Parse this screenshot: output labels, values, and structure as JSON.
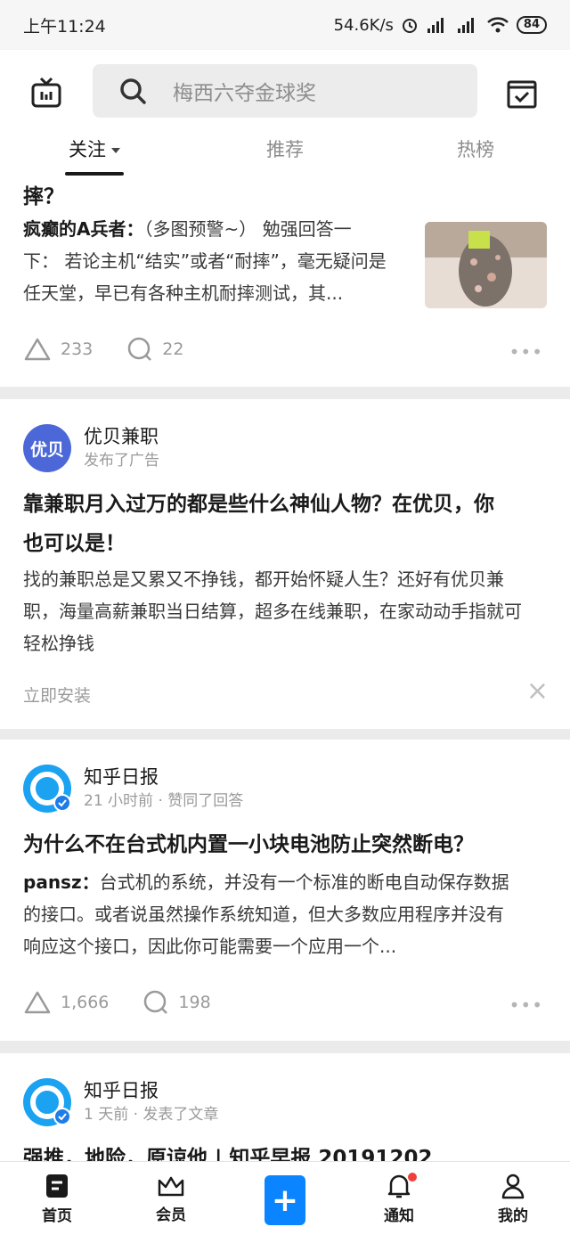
{
  "status_bar": {
    "time": "上午11:24",
    "net_speed": "54.6K/s",
    "battery": "84"
  },
  "header": {
    "search_placeholder": "梅西六夺金球奖",
    "tabs": [
      {
        "label": "关注"
      },
      {
        "label": "推荐"
      },
      {
        "label": "热榜"
      }
    ],
    "active_tab": "关注"
  },
  "feed": {
    "card1": {
      "title_tail": "摔？",
      "author": "疯癫的A兵者：",
      "excerpt": "（多图预警~） 勉强回答一下： 若论主机“结实”或者“耐摔”，毫无疑问是任天堂，早已有各种主机耐摔测试，其...",
      "likes": "233",
      "comments": "22"
    },
    "ad_card": {
      "advertiser": "优贝兼职",
      "avatar_text": "优贝",
      "meta": "发布了广告",
      "title": "靠兼职月入过万的都是些什么神仙人物？在优贝，你也可以是！",
      "excerpt": "找的兼职总是又累又不挣钱，都开始怀疑人生？还好有优贝兼职，海量高薪兼职当日结算，超多在线兼职，在家动动手指就可轻松挣钱",
      "install_label": "立即安装",
      "close_label": "×"
    },
    "card3": {
      "author_name": "知乎日报",
      "meta": "21 小时前 · 赞同了回答",
      "title": "为什么不在台式机内置一小块电池防止突然断电？",
      "answerer": "pansz：",
      "excerpt": "台式机的系统，并没有一个标准的断电自动保存数据的接口。或者说虽然操作系统知道，但大多数应用程序并没有响应这个接口，因此你可能需要一个应用一个...",
      "likes": "1,666",
      "comments": "198"
    },
    "card4": {
      "author_name": "知乎日报",
      "meta": "1 天前 · 发表了文章",
      "title_partial": "强推，地险，原谅他 | 知乎早报 20191202"
    },
    "more_label": "•••"
  },
  "bottom_nav": {
    "items": [
      {
        "label": "首页"
      },
      {
        "label": "会员"
      },
      {
        "label": "+"
      },
      {
        "label": "通知"
      },
      {
        "label": "我的"
      }
    ]
  },
  "colors": {
    "accent": "#0a84ff",
    "notify_dot": "#f1403c"
  }
}
